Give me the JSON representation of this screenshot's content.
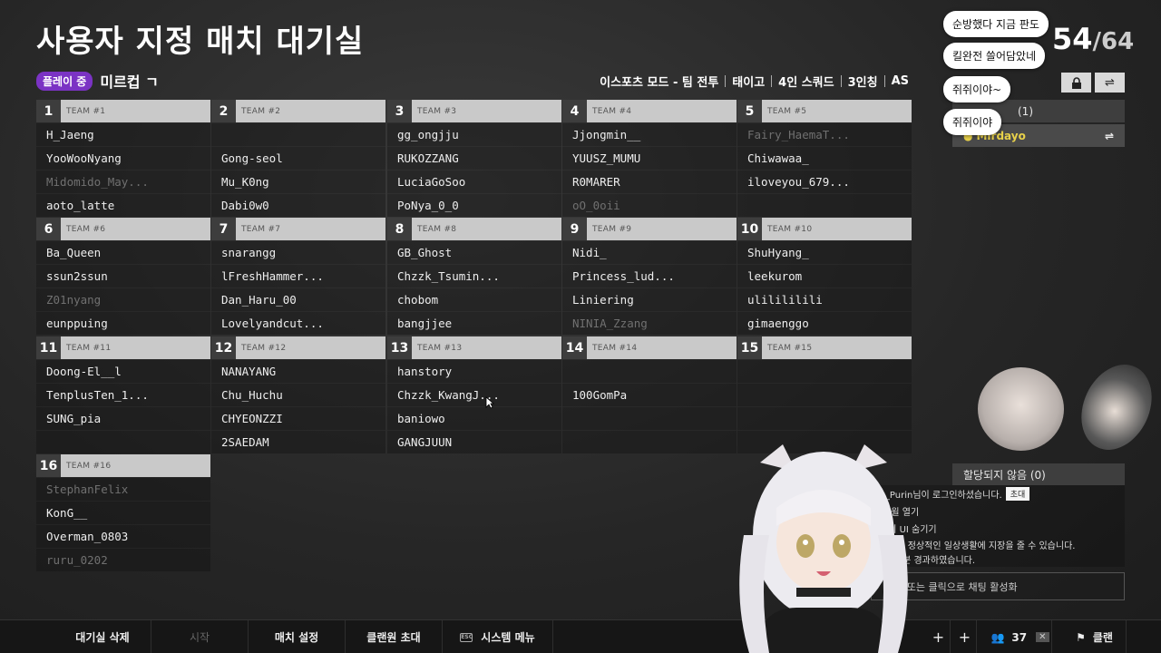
{
  "title": "사용자 지정 매치 대기실",
  "status_badge": "플레이 중",
  "room_name": "미르컵 ㄱ",
  "settings": [
    "이스포츠 모드 - 팀 전투",
    "태이고",
    "4인 스쿼드",
    "3인칭",
    "AS"
  ],
  "score": {
    "current": "54",
    "total": "/64"
  },
  "chat_bubbles": [
    "순방했다 지금 판도",
    "킬완전 쓸어담았네",
    "쥐쥐이야~",
    "쥐쥐이야"
  ],
  "side_panel": {
    "header": "(1)",
    "user": "Mirdayo"
  },
  "teams": [
    {
      "num": "1",
      "label": "TEAM #1",
      "players": [
        "H_Jaeng",
        "YooWooNyang",
        "Midomido_May...",
        "aoto_latte"
      ],
      "dim": [
        false,
        false,
        true,
        false
      ]
    },
    {
      "num": "2",
      "label": "TEAM #2",
      "players": [
        "",
        "Gong-seol",
        "Mu_K0ng",
        "Dabi0w0"
      ],
      "dim": [
        false,
        false,
        false,
        false
      ]
    },
    {
      "num": "3",
      "label": "TEAM #3",
      "players": [
        "gg_ongjju",
        "RUKOZZANG",
        "LuciaGoSoo",
        "PoNya_0_0"
      ],
      "dim": [
        false,
        false,
        false,
        false
      ]
    },
    {
      "num": "4",
      "label": "TEAM #4",
      "players": [
        "Jjongmin__",
        "YUUSZ_MUMU",
        "R0MARER",
        "oO_0oii"
      ],
      "dim": [
        false,
        false,
        false,
        true
      ]
    },
    {
      "num": "5",
      "label": "TEAM #5",
      "players": [
        "Fairy_HaemaT...",
        "Chiwawaa_",
        "iloveyou_679...",
        ""
      ],
      "dim": [
        true,
        false,
        false,
        false
      ]
    },
    {
      "num": "6",
      "label": "TEAM #6",
      "players": [
        "Ba_Queen",
        "ssun2ssun",
        "Z01nyang",
        "eunppuing"
      ],
      "dim": [
        false,
        false,
        true,
        false
      ]
    },
    {
      "num": "7",
      "label": "TEAM #7",
      "players": [
        "snarangg",
        "lFreshHammer...",
        "Dan_Haru_00",
        "Lovelyandcut..."
      ],
      "dim": [
        false,
        false,
        false,
        false
      ]
    },
    {
      "num": "8",
      "label": "TEAM #8",
      "players": [
        "GB_Ghost",
        "Chzzk_Tsumin...",
        "chobom",
        "bangjjee"
      ],
      "dim": [
        false,
        false,
        false,
        false
      ]
    },
    {
      "num": "9",
      "label": "TEAM #9",
      "players": [
        "Nidi_",
        "Princess_lud...",
        "Liniering",
        "NINIA_Zzang"
      ],
      "dim": [
        false,
        false,
        false,
        true
      ]
    },
    {
      "num": "10",
      "label": "TEAM #10",
      "players": [
        "ShuHyang_",
        "leekurom",
        "ulilililili",
        "gimaenggo"
      ],
      "dim": [
        false,
        false,
        false,
        false
      ]
    },
    {
      "num": "11",
      "label": "TEAM #11",
      "players": [
        "Doong-El__l",
        "TenplusTen_1...",
        "SUNG_pia",
        ""
      ],
      "dim": [
        false,
        false,
        false,
        false
      ]
    },
    {
      "num": "12",
      "label": "TEAM #12",
      "players": [
        "NANAYANG",
        "Chu_Huchu",
        "CHYEONZZI",
        "2SAEDAM"
      ],
      "dim": [
        false,
        false,
        false,
        false
      ]
    },
    {
      "num": "13",
      "label": "TEAM #13",
      "players": [
        "hanstory",
        "Chzzk_KwangJ...",
        "baniowo",
        "GANGJUUN"
      ],
      "dim": [
        false,
        false,
        false,
        false
      ]
    },
    {
      "num": "14",
      "label": "TEAM #14",
      "players": [
        "",
        "100GomPa",
        "",
        ""
      ],
      "dim": [
        false,
        false,
        false,
        false
      ]
    },
    {
      "num": "15",
      "label": "TEAM #15",
      "players": [
        "",
        "",
        "",
        ""
      ],
      "dim": [
        false,
        false,
        false,
        false
      ]
    },
    {
      "num": "16",
      "label": "TEAM #16",
      "players": [
        "StephanFelix",
        "KonG__",
        "Overman_0803",
        "ruru_0202"
      ],
      "dim": [
        true,
        false,
        false,
        true
      ]
    }
  ],
  "unassigned": "할당되지 않음 (0)",
  "chat_log": {
    "line1": "y_Purin님이 로그인하셨습니다.",
    "invite_label": "초대",
    "line2": "선 윌 열기",
    "line3": "로비 UI 숨기기",
    "line4": "서용은 정상적인 일상생활에 지장을 줄 수 있습니다.",
    "line5": "간 13분 경과하였습니다."
  },
  "chat_input": "TER 또는 클릭으로 채팅 활성화",
  "bottom_bar": {
    "delete_room": "대기실 삭제",
    "start": "시작",
    "match_settings": "매치 설정",
    "invite_clan": "클랜원 초대",
    "system_menu": "시스템 메뉴",
    "count": "37",
    "clan": "클랜"
  }
}
